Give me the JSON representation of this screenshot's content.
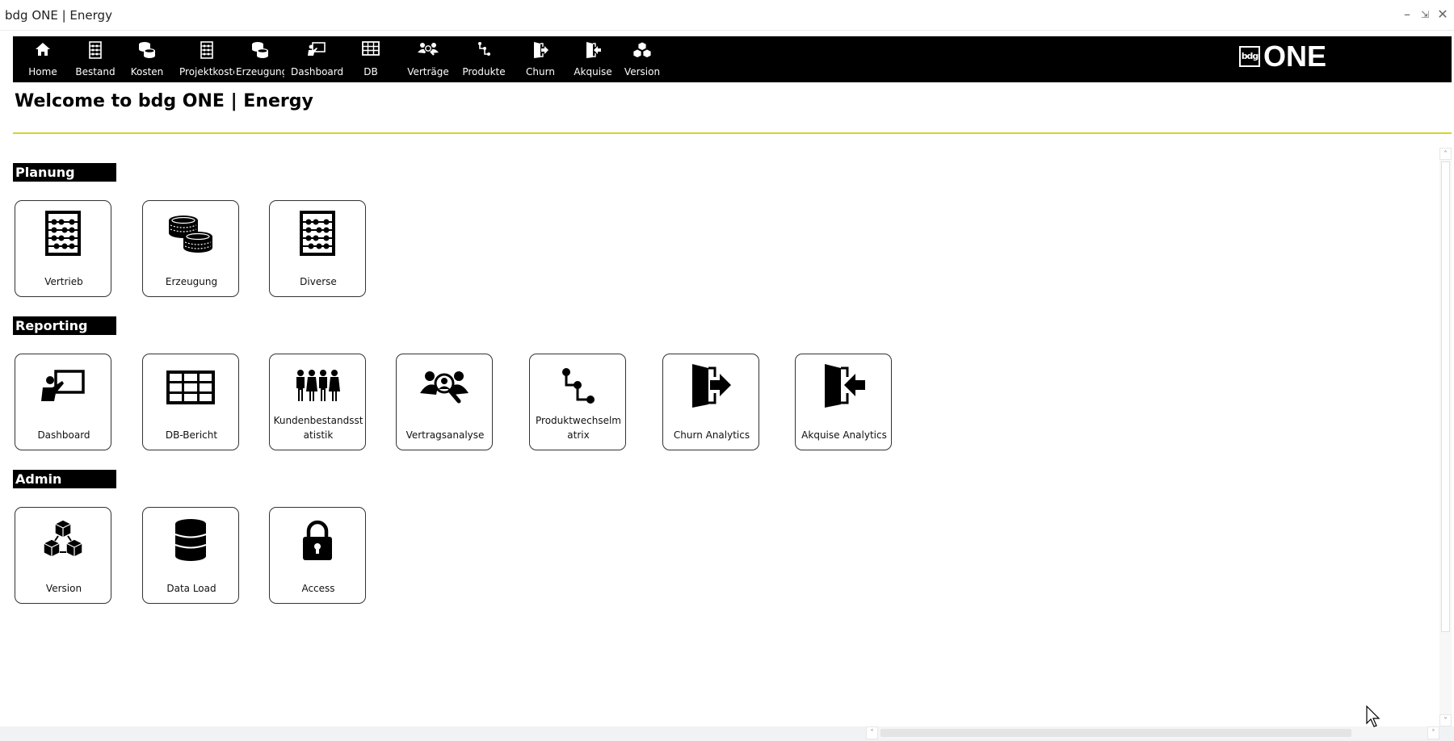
{
  "window": {
    "title": "bdg ONE | Energy",
    "controls": [
      "minimize-icon",
      "restore-icon",
      "close-icon"
    ]
  },
  "nav": {
    "items": [
      {
        "label": "Home",
        "icon": "home-icon"
      },
      {
        "label": "Bestand",
        "icon": "abacus-icon"
      },
      {
        "label": "Kosten",
        "icon": "coins-icon"
      },
      {
        "label": "Projektkoste",
        "icon": "abacus-icon"
      },
      {
        "label": "Erzeugung",
        "icon": "coins-icon"
      },
      {
        "label": "Dashboard",
        "icon": "presentation-icon"
      },
      {
        "label": "DB",
        "icon": "table-icon"
      },
      {
        "label": "Verträge",
        "icon": "people-search-icon"
      },
      {
        "label": "Produkte",
        "icon": "flow-icon"
      },
      {
        "label": "Churn",
        "icon": "exit-icon"
      },
      {
        "label": "Akquise",
        "icon": "enter-icon"
      },
      {
        "label": "Version",
        "icon": "boxes-icon"
      }
    ]
  },
  "brand": {
    "box": "bdg",
    "text": "ONE"
  },
  "welcome": "Welcome to bdg ONE | Energy",
  "accent_color": "#d7d61f",
  "sections": [
    {
      "title": "Planung",
      "tiles": [
        {
          "label": "Vertrieb",
          "icon": "abacus-icon"
        },
        {
          "label": "Erzeugung",
          "icon": "coins-icon"
        },
        {
          "label": "Diverse",
          "icon": "abacus-icon"
        }
      ]
    },
    {
      "title": "Reporting",
      "tiles": [
        {
          "label": "Dashboard",
          "icon": "presentation-icon"
        },
        {
          "label": "DB-Bericht",
          "icon": "table-icon"
        },
        {
          "label": "Kundenbestandsst atistik",
          "line1": "Kundenbestandsst",
          "line2": "atistik",
          "icon": "people-icon"
        },
        {
          "label": "Vertragsanalyse",
          "icon": "people-search-icon"
        },
        {
          "label": "Produktwechselm atrix",
          "line1": "Produktwechselm",
          "line2": "atrix",
          "icon": "flow-icon"
        },
        {
          "label": "Churn Analytics",
          "icon": "exit-icon"
        },
        {
          "label": "Akquise Analytics",
          "icon": "enter-icon"
        }
      ]
    },
    {
      "title": "Admin",
      "tiles": [
        {
          "label": "Version",
          "icon": "boxes-icon"
        },
        {
          "label": "Data Load",
          "icon": "database-icon"
        },
        {
          "label": "Access",
          "icon": "lock-icon"
        }
      ]
    }
  ]
}
